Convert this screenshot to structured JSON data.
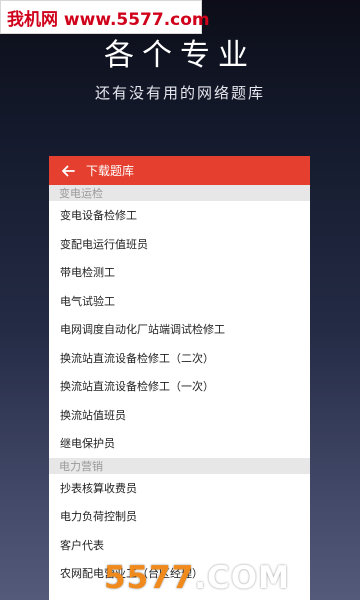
{
  "watermark_top": "我机网 www.5577.com",
  "hero": {
    "title": "各个专业",
    "subtitle": "还有没有用的网络题库"
  },
  "appbar": {
    "back_icon": "arrow-left-icon",
    "title": "下载题库"
  },
  "sections": [
    {
      "header": "变电运检",
      "items": [
        "变电设备检修工",
        "变配电运行值班员",
        "带电检测工",
        "电气试验工",
        "电网调度自动化厂站端调试检修工",
        "换流站直流设备检修工（二次）",
        "换流站直流设备检修工（一次）",
        "换流站值班员",
        "继电保护员"
      ]
    },
    {
      "header": "电力营销",
      "items": [
        "抄表核算收费员",
        "电力负荷控制员",
        "客户代表",
        "农网配电营业工（台区经理）"
      ]
    }
  ],
  "watermark_bottom": {
    "digits": "5577",
    "suffix": ".COM"
  },
  "colors": {
    "appbar": "#e5402f",
    "watermark_red": "#d0021b",
    "watermark_orange": "#f08a1c"
  }
}
